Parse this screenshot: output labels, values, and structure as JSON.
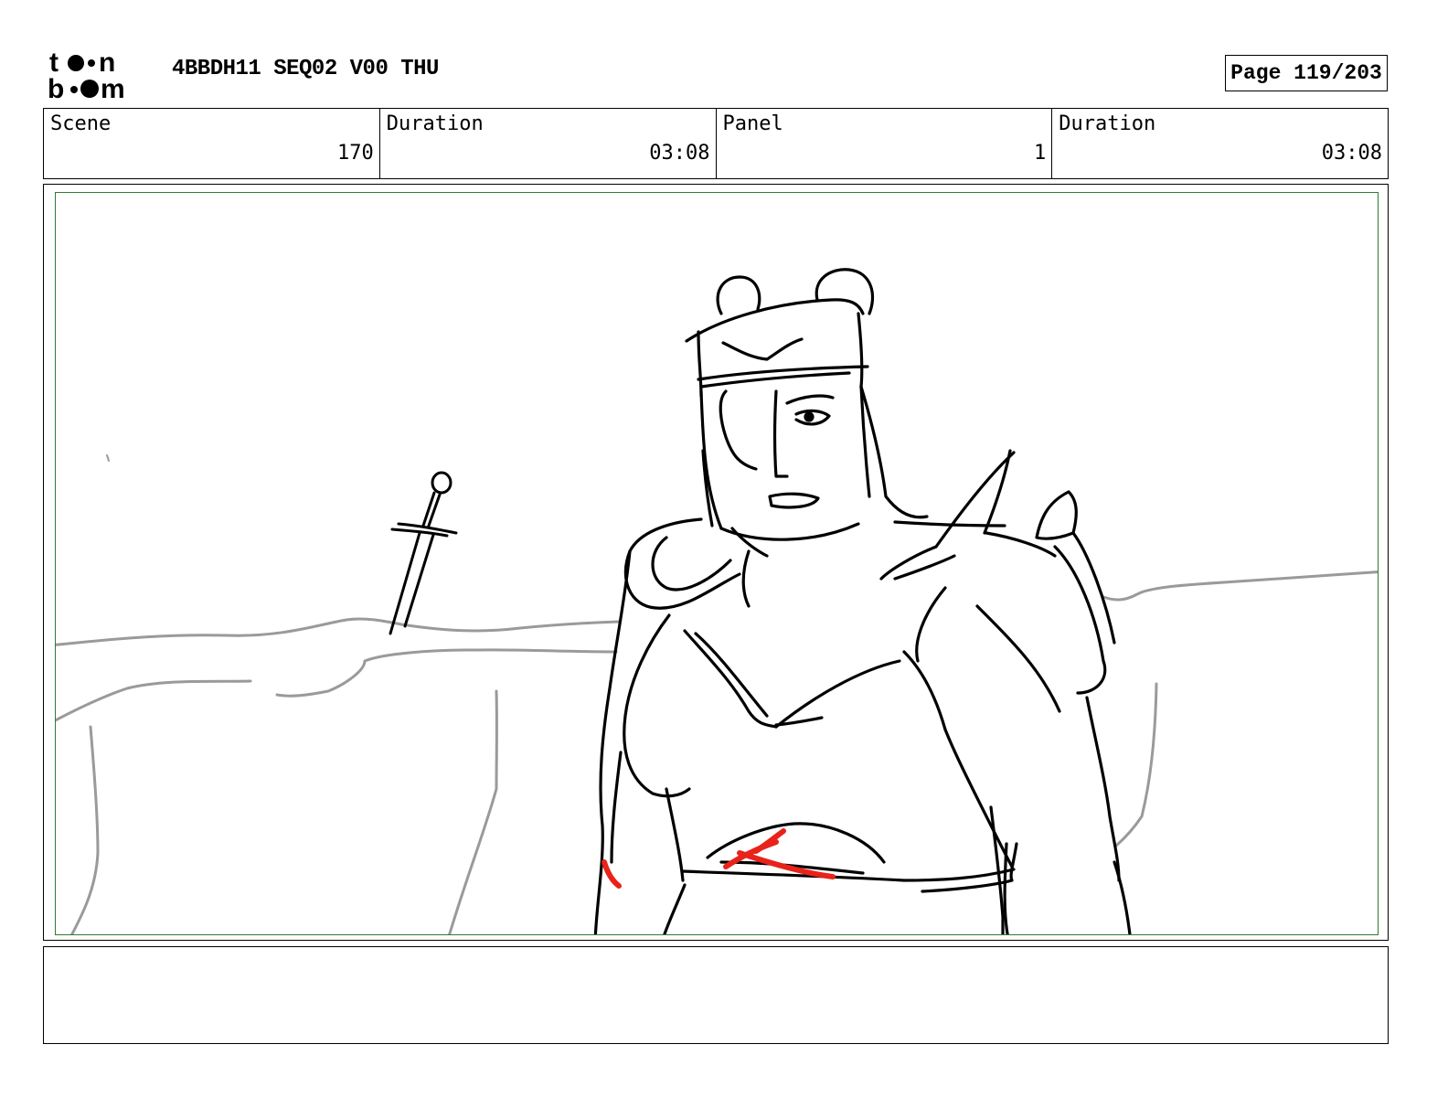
{
  "header": {
    "logo_text_top": "toon",
    "logo_text_bottom": "boom",
    "doc_title": "4BBDH11 SEQ02 V00 THU",
    "page_indicator": "Page 119/203"
  },
  "info": {
    "scene_label": "Scene",
    "scene_value": "170",
    "scene_duration_label": "Duration",
    "scene_duration_value": "03:08",
    "panel_label": "Panel",
    "panel_value": "1",
    "panel_duration_label": "Duration",
    "panel_duration_value": "03:08"
  },
  "drawing": {
    "subject": "sketch-armored-bear-warrior",
    "colors": {
      "line": "#000000",
      "background": "#9a9a9a",
      "accent": "#e8231a",
      "frame": "#2e7d32"
    }
  },
  "notes": {
    "text": ""
  }
}
